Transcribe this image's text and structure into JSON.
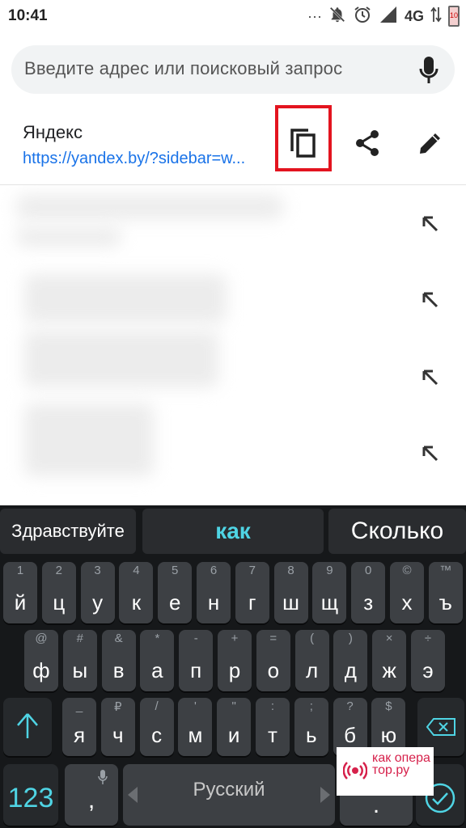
{
  "status_bar": {
    "time": "10:41",
    "overflow": "···",
    "network": "4G",
    "battery": "10"
  },
  "address_bar": {
    "placeholder": "Введите адрес или поисковый запрос"
  },
  "suggestion": {
    "title": "Яндекс",
    "url": "https://yandex.by/?sidebar=w..."
  },
  "icons": {
    "copy": "copy-icon",
    "share": "share-icon",
    "edit": "pencil-icon",
    "mic": "mic-icon",
    "arrow": "arrow-up-left-icon",
    "shift": "shift-icon",
    "backspace": "backspace-icon",
    "done": "check-circle-icon"
  },
  "colors": {
    "link": "#1a73e8",
    "highlight": "#e3141f",
    "kb_accent": "#4fd4e4",
    "kb_bg": "#16181a",
    "key": "#3d4044"
  },
  "keyboard": {
    "suggestions": [
      "Здравствуйте",
      "как",
      "Сколько"
    ],
    "row1": [
      {
        "k": "й",
        "h": "1"
      },
      {
        "k": "ц",
        "h": "2"
      },
      {
        "k": "у",
        "h": "3"
      },
      {
        "k": "к",
        "h": "4"
      },
      {
        "k": "е",
        "h": "5"
      },
      {
        "k": "н",
        "h": "6"
      },
      {
        "k": "г",
        "h": "7"
      },
      {
        "k": "ш",
        "h": "8"
      },
      {
        "k": "щ",
        "h": "9"
      },
      {
        "k": "з",
        "h": "0"
      },
      {
        "k": "х",
        "h": "©"
      },
      {
        "k": "ъ",
        "h": "™"
      }
    ],
    "row2": [
      {
        "k": "ф",
        "h": "@"
      },
      {
        "k": "ы",
        "h": "#"
      },
      {
        "k": "в",
        "h": "&"
      },
      {
        "k": "а",
        "h": "*"
      },
      {
        "k": "п",
        "h": "-"
      },
      {
        "k": "р",
        "h": "+"
      },
      {
        "k": "о",
        "h": "="
      },
      {
        "k": "л",
        "h": "("
      },
      {
        "k": "д",
        "h": ")"
      },
      {
        "k": "ж",
        "h": "×"
      },
      {
        "k": "э",
        "h": "÷"
      }
    ],
    "row3": [
      {
        "k": "я",
        "h": "_"
      },
      {
        "k": "ч",
        "h": "₽"
      },
      {
        "k": "с",
        "h": "/"
      },
      {
        "k": "м",
        "h": "'"
      },
      {
        "k": "и",
        "h": "\""
      },
      {
        "k": "т",
        "h": ":"
      },
      {
        "k": "ь",
        "h": ";"
      },
      {
        "k": "б",
        "h": "?"
      },
      {
        "k": "ю",
        "h": "$"
      }
    ],
    "numbers_key": "123",
    "comma_key": ",",
    "space_label": "Русский",
    "period_key": ".",
    "watermark": "как опера тор.ру"
  }
}
